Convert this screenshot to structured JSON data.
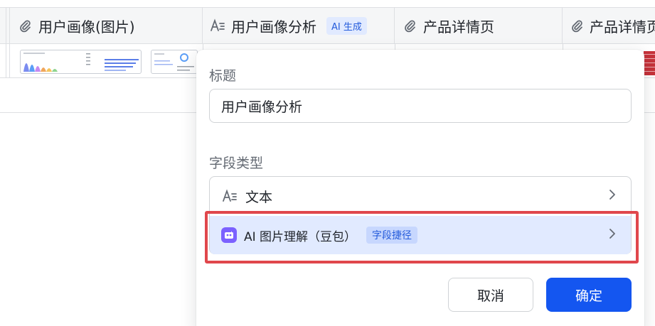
{
  "table": {
    "columns": [
      {
        "icon": "attachment-icon",
        "label": "用户画像(图片)"
      },
      {
        "icon": "text-field-icon",
        "label": "用户画像分析",
        "tag": "AI 生成"
      },
      {
        "icon": "attachment-icon",
        "label": "产品详情页"
      },
      {
        "icon": "attachment-icon",
        "label": "产品详情页"
      }
    ]
  },
  "dialog": {
    "title_label": "标题",
    "title_value": "用户画像分析",
    "field_type_label": "字段类型",
    "type_text": {
      "icon": "text-field-icon",
      "label": "文本"
    },
    "type_ai": {
      "icon": "ai-image-app-icon",
      "label": "AI 图片理解（豆包）",
      "tag": "字段捷径"
    },
    "cancel_label": "取消",
    "confirm_label": "确定"
  },
  "colors": {
    "accent": "#1456f0",
    "highlight": "#e0474c",
    "selected_bg": "#e1eaff",
    "ai_app": "#7b61ff"
  }
}
